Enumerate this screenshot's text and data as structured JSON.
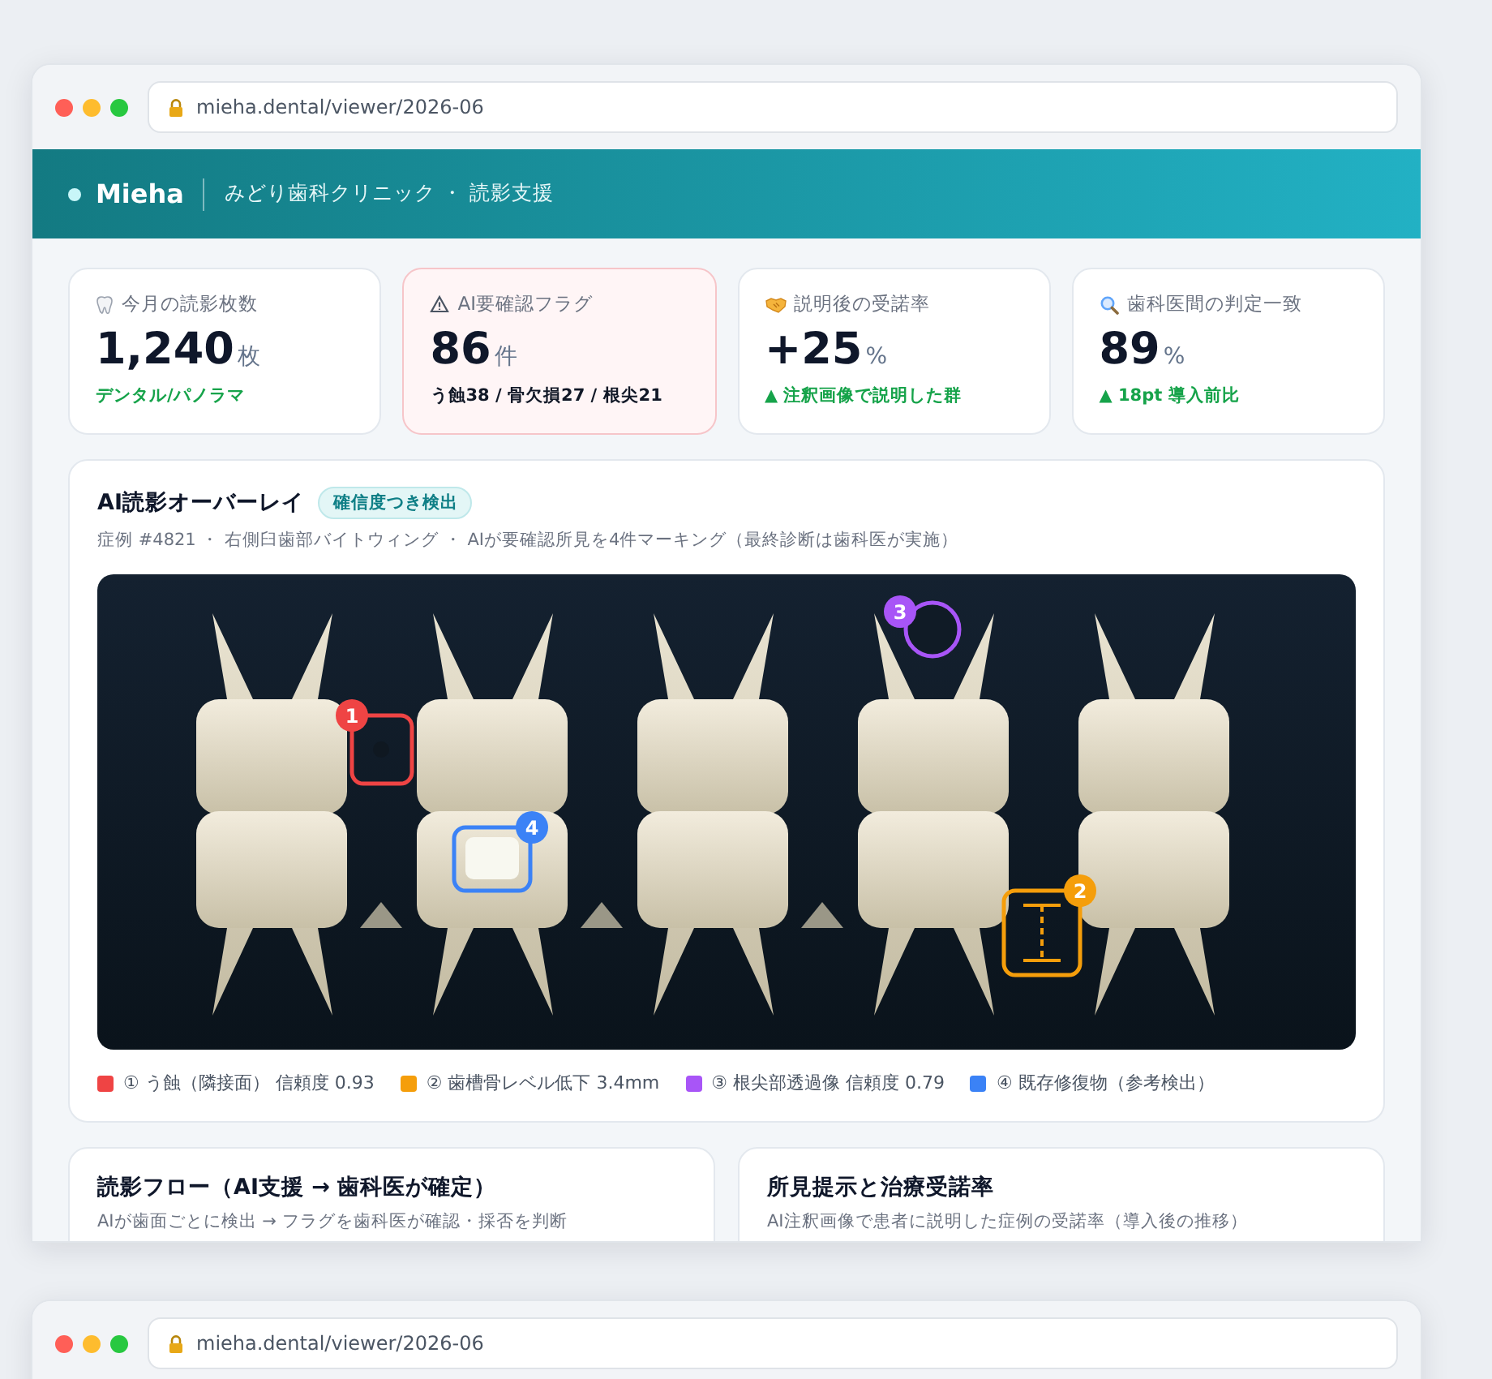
{
  "windows": [
    {
      "url": "mieha.dental/viewer/2026-06",
      "app": {
        "brand": "Mieha",
        "subtitle": "みどり歯科クリニック ・ 読影支援"
      },
      "kpis": [
        {
          "label": "今月の読影枚数",
          "value": "1,240",
          "unit": "枚",
          "note": "デンタル/パノラマ",
          "flagged": false
        },
        {
          "label": "AI要確認フラグ",
          "value": "86",
          "unit": "件",
          "note": "う蝕38 / 骨欠損27 / 根尖21",
          "flagged": true
        },
        {
          "label": "説明後の受諾率",
          "value": "+25",
          "unit": "%",
          "note": "▲ 注釈画像で説明した群",
          "flagged": false
        },
        {
          "label": "歯科医間の判定一致",
          "value": "89",
          "unit": "%",
          "note": "▲ 18pt 導入前比",
          "flagged": false
        }
      ],
      "overlay": {
        "title": "AI読影オーバーレイ",
        "badge": "確信度つき検出",
        "caption": "症例 #4821 ・ 右側臼歯部バイトウィング ・ AIが要確認所見を4件マーキング（最終診断は歯科医が実施）",
        "findings": [
          {
            "kind": "box",
            "number": "1",
            "color": "#ef4444",
            "legend": "① う蝕（隣接面） 信頼度 0.93"
          },
          {
            "kind": "measure",
            "number": "2",
            "color": "#f59e0b",
            "legend": "② 歯槽骨レベル低下 3.4mm"
          },
          {
            "kind": "circle",
            "number": "3",
            "color": "#a855f7",
            "legend": "③ 根尖部透過像 信頼度 0.79"
          },
          {
            "kind": "restoration",
            "number": "4",
            "color": "#3b82f6",
            "legend": "④ 既存修復物（参考検出）"
          }
        ]
      },
      "cards": [
        {
          "title": "読影フロー（AI支援 → 歯科医が確定）",
          "subtitle": "AIが歯面ごとに検出 → フラグを歯科医が確認・採否を判断"
        },
        {
          "title": "所見提示と治療受諾率",
          "subtitle": "AI注釈画像で患者に説明した症例の受諾率（導入後の推移）"
        }
      ]
    },
    {
      "url": "mieha.dental/viewer/2026-06"
    }
  ]
}
